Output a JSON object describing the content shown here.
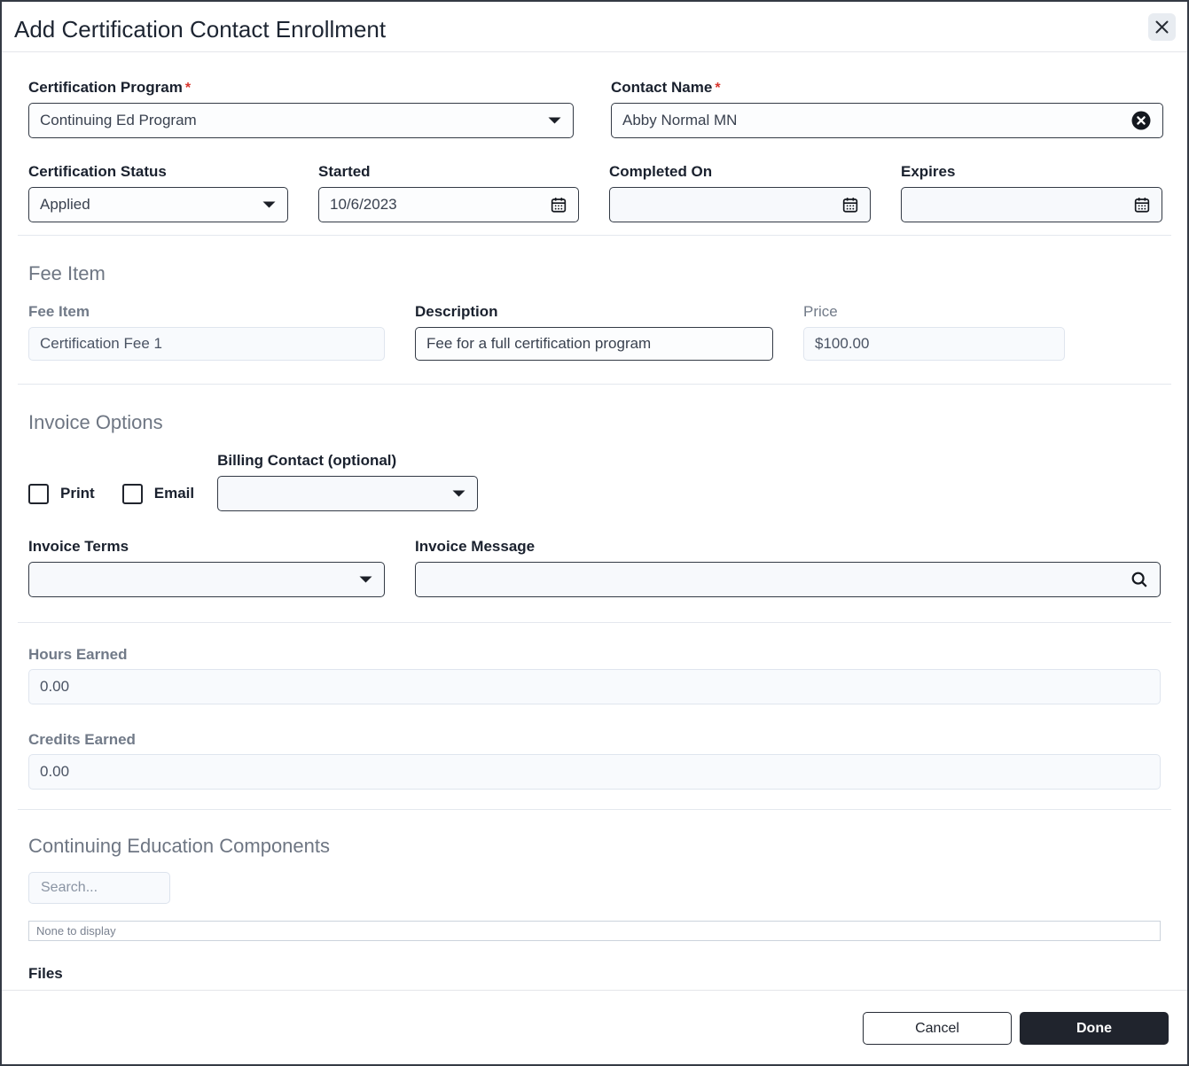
{
  "dialog": {
    "title": "Add Certification Contact Enrollment",
    "required_marker": "*"
  },
  "enrollment": {
    "certification_program": {
      "label": "Certification Program",
      "required": true,
      "value": "Continuing Ed Program"
    },
    "contact_name": {
      "label": "Contact Name",
      "required": true,
      "value": "Abby Normal MN"
    },
    "certification_status": {
      "label": "Certification Status",
      "value": "Applied"
    },
    "started": {
      "label": "Started",
      "value": "10/6/2023"
    },
    "completed_on": {
      "label": "Completed On",
      "value": ""
    },
    "expires": {
      "label": "Expires",
      "value": ""
    }
  },
  "fee_item_section": {
    "heading": "Fee Item",
    "fee_item": {
      "label": "Fee Item",
      "value": "Certification Fee 1"
    },
    "description": {
      "label": "Description",
      "value": "Fee for a full certification program"
    },
    "price": {
      "label": "Price",
      "value": "$100.00"
    }
  },
  "invoice_options": {
    "heading": "Invoice Options",
    "print_checkbox": {
      "label": "Print",
      "checked": false
    },
    "email_checkbox": {
      "label": "Email",
      "checked": false
    },
    "billing_contact": {
      "label": "Billing Contact (optional)",
      "value": ""
    },
    "invoice_terms": {
      "label": "Invoice Terms",
      "value": ""
    },
    "invoice_message": {
      "label": "Invoice Message",
      "value": ""
    }
  },
  "earned": {
    "hours_earned": {
      "label": "Hours Earned",
      "value": "0.00"
    },
    "credits_earned": {
      "label": "Credits Earned",
      "value": "0.00"
    }
  },
  "continuing_education": {
    "heading": "Continuing Education Components",
    "search_placeholder": "Search...",
    "empty_message": "None to display",
    "files_heading": "Files"
  },
  "footer": {
    "cancel_label": "Cancel",
    "done_label": "Done"
  },
  "icons": {
    "close": "close-icon",
    "clear": "clear-circle-icon",
    "calendar": "calendar-icon",
    "chevron": "chevron-down-icon",
    "search": "search-icon"
  },
  "colors": {
    "required_asterisk": "#d8342c",
    "dark_button": "#20242d",
    "label_dark": "#1a212e",
    "label_gray": "#717a88",
    "input_border_dark": "#333a45",
    "readonly_border": "#dfe5ee",
    "readonly_bg": "#f8fafd",
    "close_button_bg": "#e8ecf1"
  }
}
